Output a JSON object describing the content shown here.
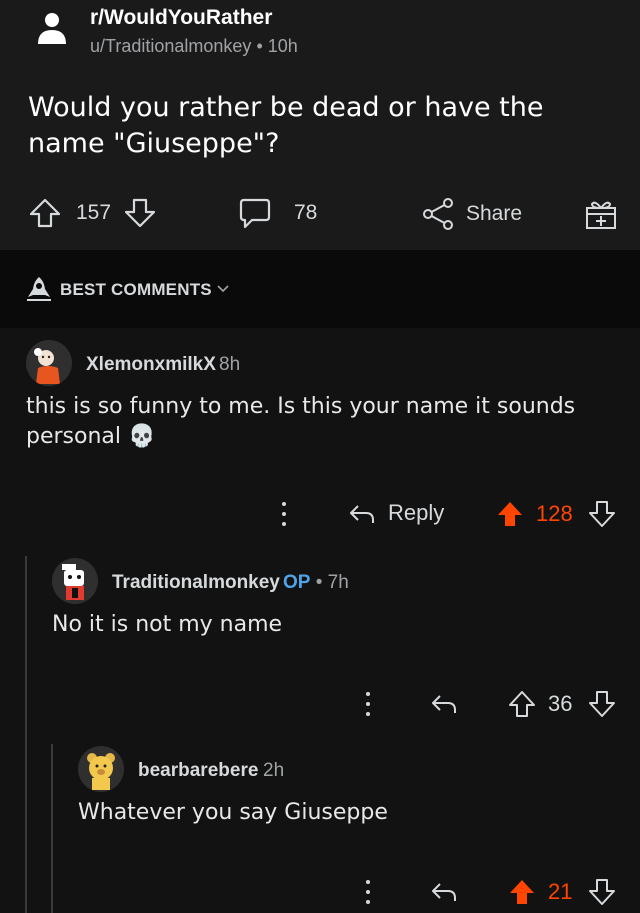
{
  "post": {
    "subreddit": "r/WouldYouRather",
    "author": "u/Traditionalmonkey",
    "age": "10h",
    "separator": "•",
    "title": "Would you rather be dead or have the name \"Giuseppe\"?",
    "upvotes": "157",
    "comments": "78",
    "share_label": "Share"
  },
  "sort": {
    "label": "BEST COMMENTS"
  },
  "comments": [
    {
      "username": "XlemonxmilkX",
      "age": "8h",
      "body": "this is so funny to me. Is this your name it sounds personal",
      "emoji": "💀",
      "reply_label": "Reply",
      "score": "128",
      "upvoted": true
    },
    {
      "username": "Traditionalmonkey",
      "op_badge": "OP",
      "separator": "•",
      "age": "7h",
      "body": "No it is not my name",
      "score": "36",
      "upvoted": false
    },
    {
      "username": "bearbarebere",
      "age": "2h",
      "body": "Whatever you say Giuseppe",
      "score": "21",
      "upvoted": true
    }
  ],
  "colors": {
    "background": "#121212",
    "post_background": "#1a1a1b",
    "upvote_orange": "#ff4500",
    "op_blue": "#4fa3e8"
  }
}
